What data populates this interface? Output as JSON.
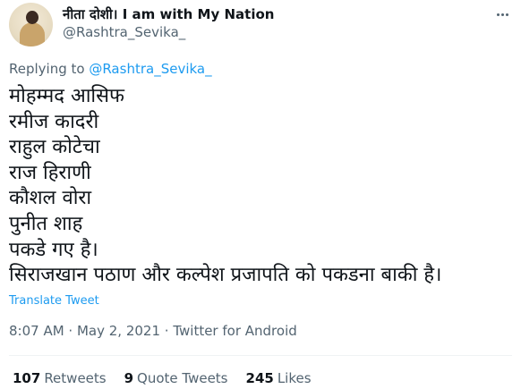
{
  "author": {
    "display_name": "नीता दोशी। I am with My Nation",
    "handle": "@Rashtra_Sevika_"
  },
  "reply": {
    "prefix": "Replying to ",
    "mention": "@Rashtra_Sevika_"
  },
  "tweet": {
    "lines": [
      "मोहम्मद आसिफ",
      "रमीज कादरी",
      "राहुल कोटेचा",
      "राज हिराणी",
      "कौशल वोरा",
      "पुनीत शाह",
      "पकडे गए है।",
      "सिराजखान पठाण और कल्पेश प्रजापति को पकडना बाकी है।"
    ]
  },
  "translate_label": "Translate Tweet",
  "meta": {
    "time": "8:07 AM",
    "date": "May 2, 2021",
    "source": "Twitter for Android",
    "separator": " · "
  },
  "stats": {
    "retweets_count": "107",
    "retweets_label": "Retweets",
    "quotes_count": "9",
    "quotes_label": "Quote Tweets",
    "likes_count": "245",
    "likes_label": "Likes"
  }
}
